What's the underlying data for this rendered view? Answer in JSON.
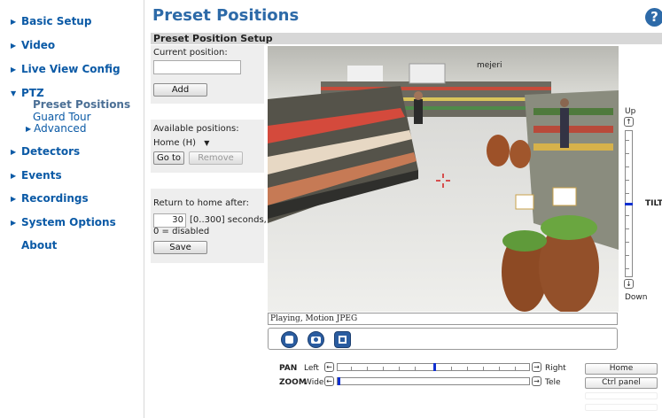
{
  "sidebar": {
    "items": [
      {
        "label": "Basic Setup"
      },
      {
        "label": "Video"
      },
      {
        "label": "Live View Config"
      },
      {
        "label": "PTZ"
      },
      {
        "label": "Detectors"
      },
      {
        "label": "Events"
      },
      {
        "label": "Recordings"
      },
      {
        "label": "System Options"
      },
      {
        "label": "About"
      }
    ],
    "ptz_sub": [
      {
        "label": "Preset Positions"
      },
      {
        "label": "Guard Tour"
      },
      {
        "label": "Advanced"
      }
    ]
  },
  "header": {
    "title": "Preset Positions",
    "help": "?"
  },
  "section": {
    "title": "Preset Position Setup"
  },
  "current": {
    "label": "Current position:",
    "value": "",
    "add_label": "Add"
  },
  "available": {
    "label": "Available positions:",
    "selected": "Home (H)",
    "goto_label": "Go to",
    "remove_label": "Remove"
  },
  "home": {
    "label": "Return to home after:",
    "value": "30",
    "range": "[0..300] seconds,",
    "note": "0 = disabled",
    "save_label": "Save"
  },
  "video": {
    "status": "Playing, Motion JPEG",
    "sign": "mejeri"
  },
  "tilt": {
    "title": "TILT",
    "up": "Up",
    "down": "Down",
    "position": 0.5
  },
  "pan": {
    "title": "PAN",
    "left": "Left",
    "right": "Right",
    "position": 0.5
  },
  "zoom": {
    "title": "ZOOM",
    "wide": "Wide",
    "tele": "Tele",
    "position": 0.0
  },
  "buttons": {
    "home": "Home",
    "ctrl_panel": "Ctrl panel"
  },
  "colors": {
    "link": "#0b5aa6",
    "title": "#2d6aa8",
    "indicator": "#1030d0"
  }
}
